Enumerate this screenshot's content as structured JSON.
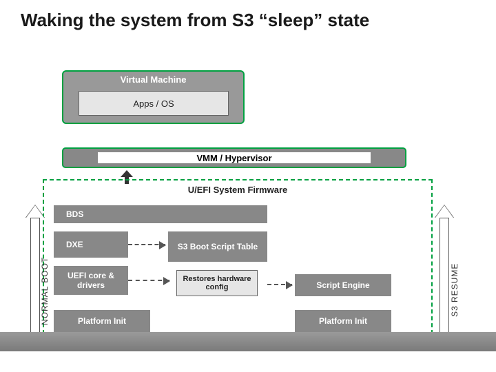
{
  "title": "Waking the system from S3  “sleep” state",
  "vm": {
    "label": "Virtual Machine",
    "apps": "Apps / OS"
  },
  "vmm": "VMM / Hypervisor",
  "fw_title": "U/EFI System Firmware",
  "normal_boot_label": "NORMAL BOOT",
  "s3_resume_label": "S3 RESUME",
  "bds": "BDS",
  "dxe": "DXE",
  "uefi_core": "UEFI core & drivers",
  "platform_init": "Platform Init",
  "s3_table": "S3 Boot Script Table",
  "restores": "Restores hardware config",
  "script_engine": "Script Engine"
}
